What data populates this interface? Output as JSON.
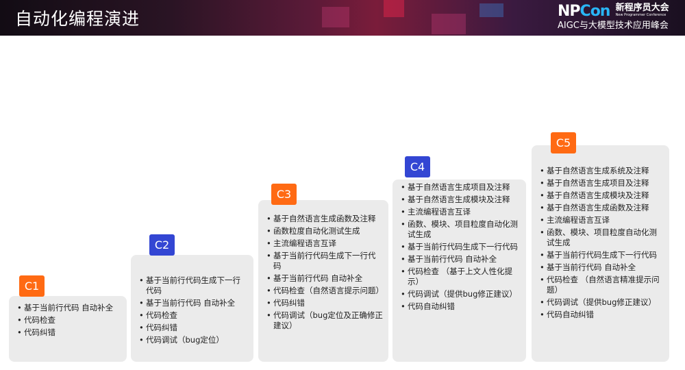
{
  "header": {
    "title": "自动化编程演进",
    "logo": {
      "brand": "NPCon",
      "name": "新程序员大会",
      "tagline": "New Programmer Conference",
      "subtitle": "AIGC与大模型技术应用峰会"
    }
  },
  "colors": {
    "orange": "#ff6a13",
    "blue": "#3346d3",
    "card": "#ebebeb"
  },
  "levels": [
    {
      "label": "C1",
      "items": [
        "基于当前行代码 自动补全",
        "代码检查",
        "代码纠错"
      ]
    },
    {
      "label": "C2",
      "items": [
        "基于当前行代码生成下一行代码",
        "基于当前行代码 自动补全",
        "代码检查",
        "代码纠错",
        "代码调试（bug定位）"
      ]
    },
    {
      "label": "C3",
      "items": [
        "基于自然语言生成函数及注释",
        "函数粒度自动化测试生成",
        "主流编程语言互译",
        "基于当前行代码生成下一行代码",
        "基于当前行代码 自动补全",
        "代码检查（自然语言提示问题）",
        "代码纠错",
        "代码调试（bug定位及正确修正建议）"
      ]
    },
    {
      "label": "C4",
      "items": [
        "基于自然语言生成项目及注释",
        "基于自然语言生成模块及注释",
        "主流编程语言互译",
        "函数、模块、项目粒度自动化测试生成",
        "基于当前行代码生成下一行代码",
        "基于当前行代码 自动补全",
        "代码检查 （基于上文人性化提示）",
        "代码调试（提供bug修正建议）",
        "代码自动纠错"
      ]
    },
    {
      "label": "C5",
      "items": [
        "基于自然语言生成系统及注释",
        "基于自然语言生成项目及注释",
        "基于自然语言生成模块及注释",
        "基于自然语言生成函数及注释",
        "主流编程语言互译",
        "函数、模块、项目粒度自动化测试生成",
        "基于当前行代码生成下一行代码",
        "基于当前行代码 自动补全",
        "代码检查 （自然语言精准提示问题）",
        "代码调试（提供bug修正建议）",
        "代码自动纠错"
      ]
    }
  ]
}
